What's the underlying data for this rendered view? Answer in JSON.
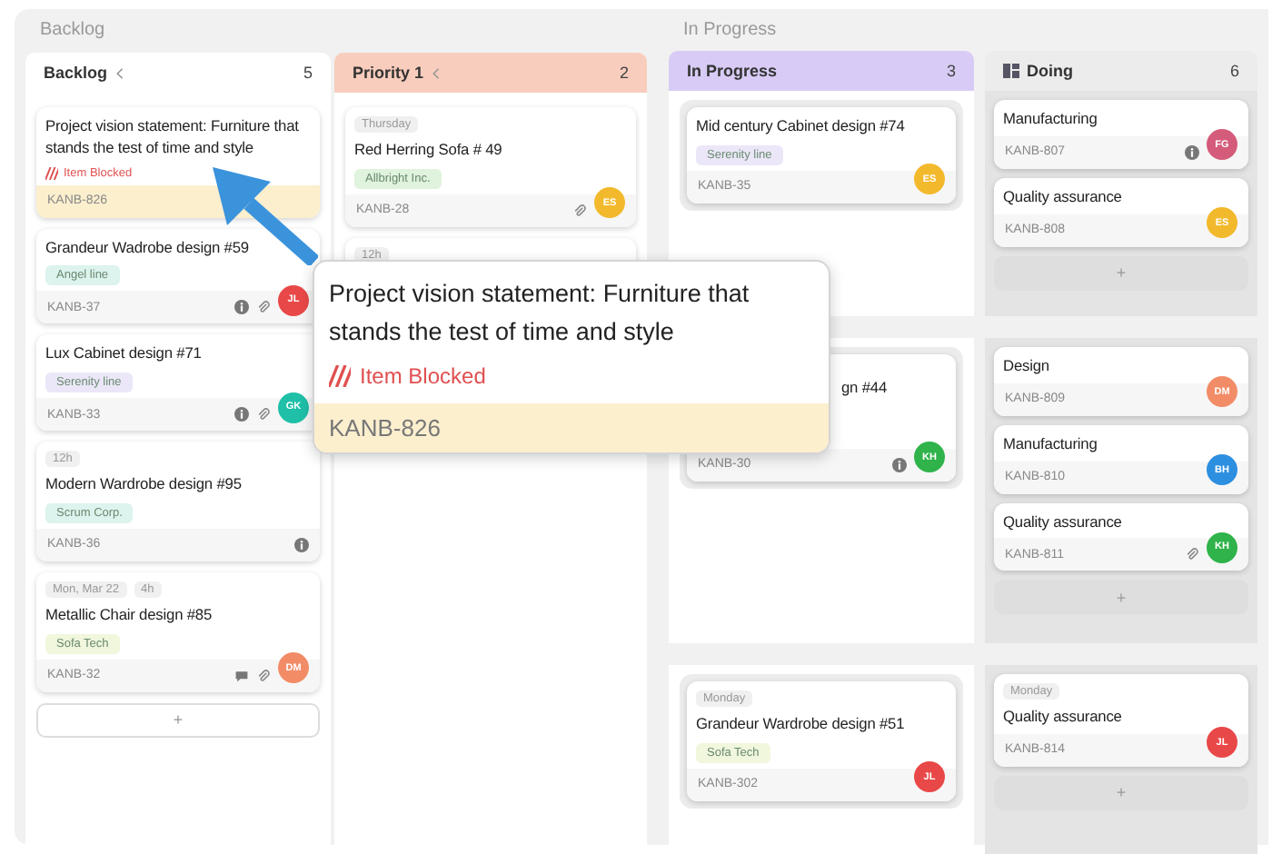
{
  "groups": [
    {
      "title": "Backlog",
      "columns": [
        {
          "title": "Backlog",
          "count": "5",
          "kind": "collapsible",
          "color": "#ffffff",
          "add_button": "+",
          "cards": [
            {
              "title": "Project vision statement: Furniture that stands the test of time and style",
              "blocked": "Item Blocked",
              "id": "KANB-826"
            },
            {
              "title": "Grandeur Wadrobe design #59",
              "tag": {
                "text": "Angel line",
                "color": "#dcf3ee"
              },
              "id": "KANB-37",
              "icons": [
                {
                  "kind": "info"
                },
                {
                  "kind": "clip"
                }
              ],
              "avatar": {
                "initials": "JL",
                "color": "#e94848"
              }
            },
            {
              "title": "Lux Cabinet design #71",
              "tag": {
                "text": "Serenity line",
                "color": "#ebe7f8"
              },
              "id": "KANB-33",
              "icons": [
                {
                  "kind": "info"
                },
                {
                  "kind": "clip"
                }
              ],
              "avatar": {
                "initials": "GK",
                "color": "#1fbfa8"
              }
            },
            {
              "chips": [
                "12h"
              ],
              "title": "Modern Wardrobe design #95",
              "tag": {
                "text": "Scrum Corp.",
                "color": "#dcf3ee"
              },
              "id": "KANB-36",
              "icons": [
                {
                  "kind": "info"
                }
              ]
            },
            {
              "chips": [
                "Mon, Mar 22",
                "4h"
              ],
              "title": "Metallic Chair design #85",
              "tag": {
                "text": "Sofa Tech",
                "color": "#f0f7dc"
              },
              "id": "KANB-32",
              "icons": [
                {
                  "kind": "comment"
                },
                {
                  "kind": "clip"
                }
              ],
              "avatar": {
                "initials": "DM",
                "color": "#f28c67"
              }
            }
          ]
        },
        {
          "title": "Priority 1",
          "count": "2",
          "kind": "collapsible",
          "color": "#f9cdbd",
          "cards": [
            {
              "chips": [
                "Thursday"
              ],
              "title": "Red Herring Sofa # 49",
              "tag": {
                "text": "Allbright Inc.",
                "color": "#e0f3dc"
              },
              "id": "KANB-28",
              "icons": [
                {
                  "kind": "clip"
                }
              ],
              "avatar": {
                "initials": "ES",
                "color": "#f3b92c"
              }
            },
            {
              "chips": [
                "12h"
              ]
            }
          ]
        }
      ]
    },
    {
      "title": "In Progress",
      "columns": [
        {
          "title": "In Progress",
          "count": "3",
          "kind": "plain",
          "color": "#d8ccf6"
        },
        {
          "title": "Doing",
          "count": "6",
          "kind": "board",
          "color": "#ececec"
        }
      ],
      "lanes": [
        {
          "cells": [
            {
              "cards": [
                {
                  "title": "Mid century Cabinet design #74",
                  "tag": {
                    "text": "Serenity line",
                    "color": "#ebe7f8"
                  },
                  "id": "KANB-35",
                  "avatar": {
                    "initials": "ES",
                    "color": "#f3b92c"
                  }
                }
              ]
            },
            {
              "add_button": "+",
              "cards": [
                {
                  "title": "Manufacturing",
                  "id": "KANB-807",
                  "icons": [
                    {
                      "kind": "info"
                    }
                  ],
                  "avatar": {
                    "initials": "FG",
                    "color": "#d45b7a"
                  }
                },
                {
                  "title": "Quality assurance",
                  "id": "KANB-808",
                  "avatar": {
                    "initials": "ES",
                    "color": "#f3b92c"
                  }
                }
              ]
            }
          ]
        },
        {
          "cells": [
            {
              "cards": [
                {
                  "title": "gn #44",
                  "covered": true,
                  "id": "KANB-30",
                  "icons": [
                    {
                      "kind": "info"
                    }
                  ],
                  "avatar": {
                    "initials": "KH",
                    "color": "#2fb34a"
                  }
                }
              ]
            },
            {
              "add_button": "+",
              "cards": [
                {
                  "title": "Design",
                  "id": "KANB-809",
                  "avatar": {
                    "initials": "DM",
                    "color": "#f28c67"
                  }
                },
                {
                  "title": "Manufacturing",
                  "id": "KANB-810",
                  "avatar": {
                    "initials": "BH",
                    "color": "#2d8fe0"
                  }
                },
                {
                  "title": "Quality assurance",
                  "id": "KANB-811",
                  "icons": [
                    {
                      "kind": "clip"
                    }
                  ],
                  "avatar": {
                    "initials": "KH",
                    "color": "#2fb34a"
                  }
                }
              ]
            }
          ]
        },
        {
          "cells": [
            {
              "cards": [
                {
                  "chips": [
                    "Monday"
                  ],
                  "title": "Grandeur Wardrobe design #51",
                  "tag": {
                    "text": "Sofa Tech",
                    "color": "#f0f7dc"
                  },
                  "id": "KANB-302",
                  "avatar": {
                    "initials": "JL",
                    "color": "#e94848"
                  }
                }
              ]
            },
            {
              "add_button": "+",
              "cards": [
                {
                  "chips": [
                    "Monday"
                  ],
                  "title": "Quality assurance",
                  "id": "KANB-814",
                  "avatar": {
                    "initials": "JL",
                    "color": "#e94848"
                  }
                }
              ]
            }
          ]
        }
      ]
    }
  ],
  "popup": {
    "title": "Project vision statement: Furniture that stands the test of time and style",
    "blocked": "Item Blocked",
    "id": "KANB-826"
  }
}
